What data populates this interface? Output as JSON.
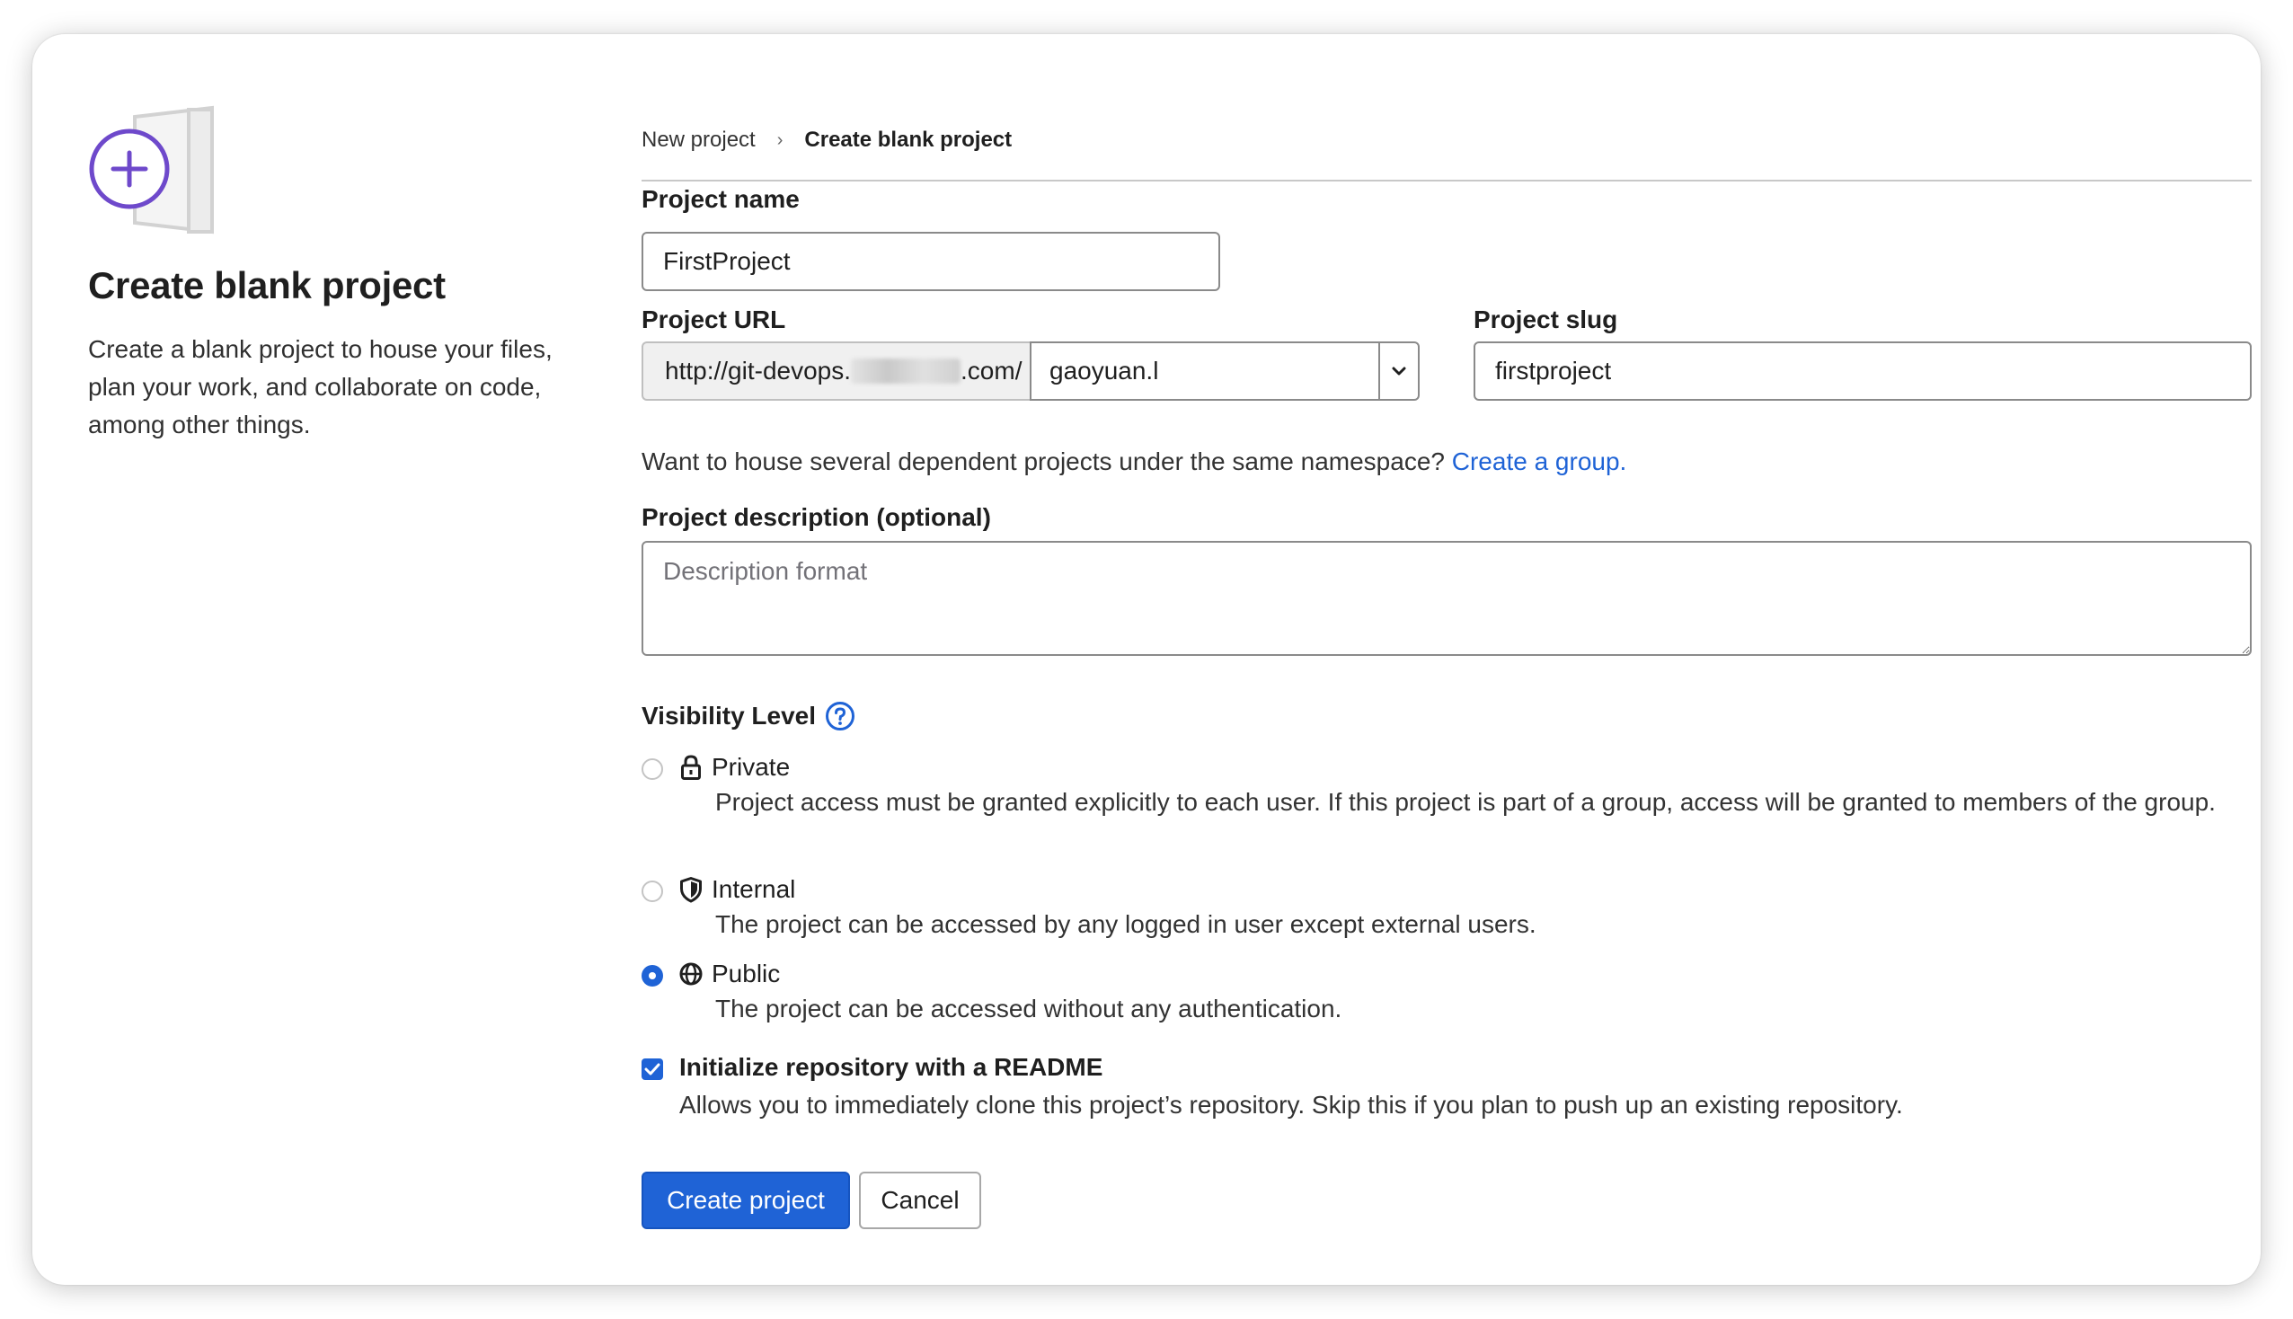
{
  "sidebar": {
    "title": "Create blank project",
    "description": "Create a blank project to house your files, plan your work, and collaborate on code, among other things."
  },
  "breadcrumb": {
    "parent": "New project",
    "separator": "›",
    "current": "Create blank project"
  },
  "form": {
    "project_name": {
      "label": "Project name",
      "value": "FirstProject"
    },
    "project_url": {
      "label": "Project URL",
      "prefix_start": "http://git-devops.",
      "prefix_end": ".com/",
      "namespace": "gaoyuan.l"
    },
    "project_slug": {
      "label": "Project slug",
      "value": "firstproject"
    },
    "namespace_help": {
      "text": "Want to house several dependent projects under the same namespace?",
      "link": "Create a group."
    },
    "description": {
      "label": "Project description (optional)",
      "placeholder": "Description format",
      "value": ""
    },
    "visibility": {
      "label": "Visibility Level",
      "selected": "Public",
      "options": [
        {
          "title": "Private",
          "icon": "lock-icon",
          "description": "Project access must be granted explicitly to each user. If this project is part of a group, access will be granted to members of the group."
        },
        {
          "title": "Internal",
          "icon": "shield-icon",
          "description": "The project can be accessed by any logged in user except external users."
        },
        {
          "title": "Public",
          "icon": "globe-icon",
          "description": "The project can be accessed without any authentication."
        }
      ]
    },
    "readme": {
      "checked": true,
      "label": "Initialize repository with a README",
      "description": "Allows you to immediately clone this project’s repository. Skip this if you plan to push up an existing repository."
    },
    "buttons": {
      "create": "Create project",
      "cancel": "Cancel"
    }
  },
  "colors": {
    "accent": "#1f63d6",
    "illustration_purple": "#6e49cb"
  }
}
